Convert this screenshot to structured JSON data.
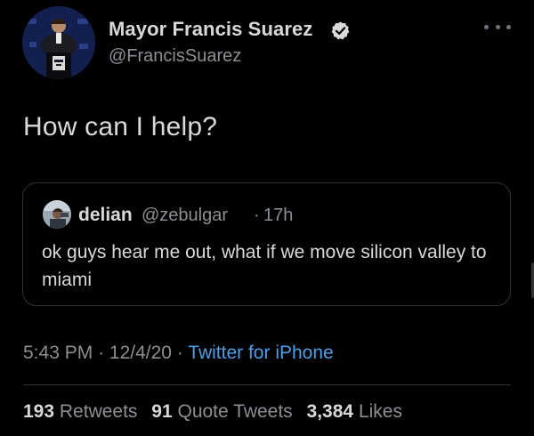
{
  "tweet": {
    "author": {
      "name": "Mayor Francis Suarez",
      "handle": "@FrancisSuarez",
      "verified": true,
      "avatar_icon": "avatar-photo-icon"
    },
    "text": "How can I help?",
    "quoted": {
      "author_name": "delian",
      "author_handle": "@zebulgar",
      "separator": "·",
      "time": "17h",
      "text": "ok guys hear me out, what if we move silicon valley to miami"
    },
    "meta": {
      "time": "5:43 PM",
      "separator": "·",
      "date": "12/4/20",
      "source": "Twitter for iPhone"
    },
    "stats": {
      "retweets_count": "193",
      "retweets_label": "Retweets",
      "quotes_count": "91",
      "quotes_label": "Quote Tweets",
      "likes_count": "3,384",
      "likes_label": "Likes"
    }
  },
  "colors": {
    "background": "#000000",
    "text_primary": "#d9d9d9",
    "text_secondary": "#8b8f94",
    "link": "#4a9fe8",
    "border": "#2f3336"
  }
}
